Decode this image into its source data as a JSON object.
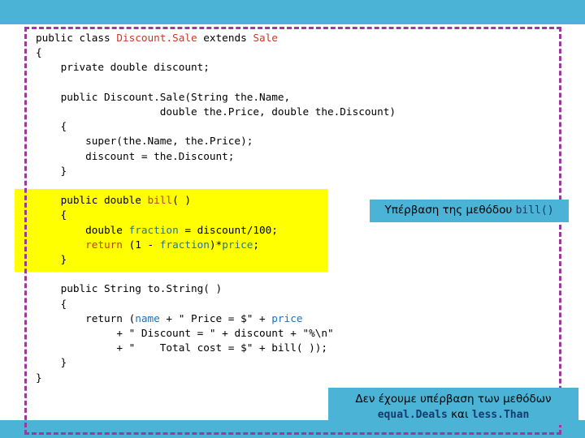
{
  "slide": {
    "top_band_color": "#4ab3d6",
    "bottom_band_color": "#4ab3d6",
    "frame_color": "#9a3b9a",
    "highlight_color": "#ffff00",
    "code_lines": [
      "public class Discount.Sale extends Sale",
      "{",
      "    private double discount;",
      "",
      "    public Discount.Sale(String the.Name,",
      "                    double the.Price, double the.Discount)",
      "    {",
      "        super(the.Name, the.Price);",
      "        discount = the.Discount;",
      "    }",
      "",
      "    public double bill( )",
      "    {",
      "        double fraction = discount/100;",
      "        return (1 - fraction)*price;",
      "    }",
      "",
      "    public String to.String( )",
      "    {",
      "        return (name + \" Price = $\" + price",
      "             + \" Discount = \" + discount + \"%\\n\"",
      "             + \"    Total cost = $\" + bill( ));",
      "    }",
      "}"
    ]
  },
  "callouts": {
    "first": {
      "text_before": "Υπέρβαση της μεθόδου ",
      "code": "bill()",
      "text_after": ""
    },
    "second": {
      "line1": "Δεν έχουμε υπέρβαση των μεθόδων",
      "code1": "equal.Deals",
      "between": " και ",
      "code2": "less.Than"
    }
  }
}
